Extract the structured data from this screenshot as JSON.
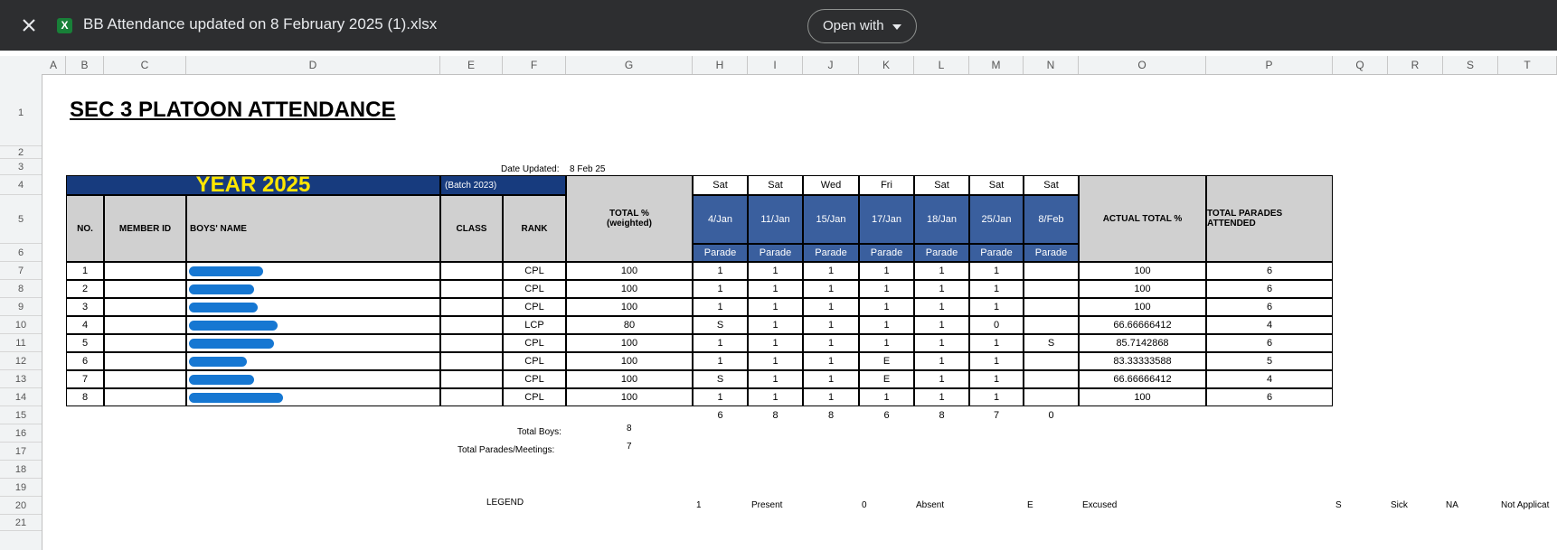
{
  "viewer": {
    "file_name": "BB Attendance updated on 8 February 2025 (1).xlsx",
    "file_icon_letter": "X",
    "open_with_label": "Open with",
    "close_icon": "close-icon",
    "menu_icon": "caret-down-icon"
  },
  "columns": [
    "A",
    "B",
    "C",
    "D",
    "E",
    "F",
    "G",
    "H",
    "I",
    "J",
    "K",
    "L",
    "M",
    "N",
    "O",
    "P",
    "Q",
    "R",
    "S",
    "T"
  ],
  "rows": [
    "1",
    "2",
    "3",
    "4",
    "5",
    "6",
    "7",
    "8",
    "9",
    "10",
    "11",
    "12",
    "13",
    "14",
    "15",
    "16",
    "17",
    "18",
    "19",
    "20",
    "21"
  ],
  "sheet": {
    "title": "SEC 3 PLATOON ATTENDANCE",
    "date_updated_label": "Date Updated:",
    "date_updated_value": "8 Feb 25",
    "year_label": "YEAR 2025",
    "batch_label": "(Batch 2023)",
    "total_pct_label": "TOTAL %",
    "total_pct_sub": "(weighted)",
    "actual_total_label": "ACTUAL TOTAL %",
    "total_parades_label": "TOTAL PARADES ATTENDED",
    "headers": {
      "no": "NO.",
      "member_id": "MEMBER ID",
      "name": "BOYS' NAME",
      "class": "CLASS",
      "rank": "RANK"
    },
    "dates": [
      {
        "day": "Sat",
        "date": "4/Jan",
        "type": "Parade"
      },
      {
        "day": "Sat",
        "date": "11/Jan",
        "type": "Parade"
      },
      {
        "day": "Wed",
        "date": "15/Jan",
        "type": "Parade"
      },
      {
        "day": "Fri",
        "date": "17/Jan",
        "type": "Parade"
      },
      {
        "day": "Sat",
        "date": "18/Jan",
        "type": "Parade"
      },
      {
        "day": "Sat",
        "date": "25/Jan",
        "type": "Parade"
      },
      {
        "day": "Sat",
        "date": "8/Feb",
        "type": "Parade"
      }
    ],
    "members": [
      {
        "no": "1",
        "rank": "CPL",
        "total": "100",
        "att": [
          "1",
          "1",
          "1",
          "1",
          "1",
          "1",
          ""
        ],
        "actual": "100",
        "attended": "6"
      },
      {
        "no": "2",
        "rank": "CPL",
        "total": "100",
        "att": [
          "1",
          "1",
          "1",
          "1",
          "1",
          "1",
          ""
        ],
        "actual": "100",
        "attended": "6"
      },
      {
        "no": "3",
        "rank": "CPL",
        "total": "100",
        "att": [
          "1",
          "1",
          "1",
          "1",
          "1",
          "1",
          ""
        ],
        "actual": "100",
        "attended": "6"
      },
      {
        "no": "4",
        "rank": "LCP",
        "total": "80",
        "att": [
          "S",
          "1",
          "1",
          "1",
          "1",
          "0",
          ""
        ],
        "actual": "66.66666412",
        "attended": "4"
      },
      {
        "no": "5",
        "rank": "CPL",
        "total": "100",
        "att": [
          "1",
          "1",
          "1",
          "1",
          "1",
          "1",
          "S"
        ],
        "actual": "85.7142868",
        "attended": "6"
      },
      {
        "no": "6",
        "rank": "CPL",
        "total": "100",
        "att": [
          "1",
          "1",
          "1",
          "E",
          "1",
          "1",
          ""
        ],
        "actual": "83.33333588",
        "attended": "5"
      },
      {
        "no": "7",
        "rank": "CPL",
        "total": "100",
        "att": [
          "S",
          "1",
          "1",
          "E",
          "1",
          "1",
          ""
        ],
        "actual": "66.66666412",
        "attended": "4"
      },
      {
        "no": "8",
        "rank": "CPL",
        "total": "100",
        "att": [
          "1",
          "1",
          "1",
          "1",
          "1",
          "1",
          ""
        ],
        "actual": "100",
        "attended": "6"
      }
    ],
    "column_totals": [
      "6",
      "8",
      "8",
      "6",
      "8",
      "7",
      "0"
    ],
    "total_boys_label": "Total Boys:",
    "total_boys_value": "8",
    "total_parades_meetings_label": "Total Parades/Meetings:",
    "total_parades_meetings_value": "7",
    "legend_label": "LEGEND",
    "legend": [
      {
        "code": "1",
        "meaning": "Present"
      },
      {
        "code": "0",
        "meaning": "Absent"
      },
      {
        "code": "E",
        "meaning": "Excused"
      },
      {
        "code": "S",
        "meaning": "Sick"
      },
      {
        "code": "NA",
        "meaning": "Not Applicat"
      }
    ]
  },
  "colors": {
    "topbar": "#2d2e30",
    "year_header": "#173b7e",
    "year_text": "#ffe600",
    "date_header": "#3a5f9e",
    "grey_header": "#d0d0d0",
    "redaction": "#1677d2",
    "excel_green": "#188038"
  }
}
